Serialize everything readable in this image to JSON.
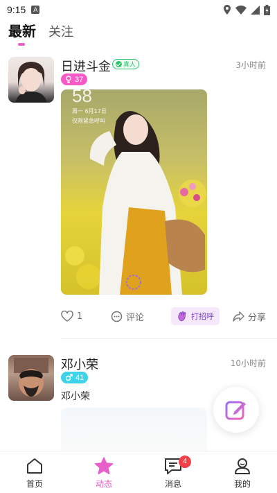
{
  "status_bar": {
    "time": "9:15",
    "notif_icon": "A"
  },
  "tabs": [
    {
      "label": "最新",
      "active": true
    },
    {
      "label": "关注",
      "active": false
    }
  ],
  "posts": [
    {
      "username": "日进斗金",
      "verified_label": "真人",
      "time": "3小时前",
      "level": "37",
      "gender": "female",
      "photo_overlay": {
        "clock": "58",
        "date": "周一 6月17日",
        "note": "仅限紧急呼叫"
      },
      "actions": {
        "likes": "1",
        "comment": "评论",
        "greet": "打招呼",
        "share": "分享"
      }
    },
    {
      "username": "邓小荣",
      "time": "10小时前",
      "level": "41",
      "gender": "male",
      "text": "邓小荣"
    }
  ],
  "bottom_nav": [
    {
      "label": "首页",
      "icon": "home-icon",
      "active": false
    },
    {
      "label": "动态",
      "icon": "star-icon",
      "active": true
    },
    {
      "label": "消息",
      "icon": "chat-icon",
      "active": false,
      "badge": "4"
    },
    {
      "label": "我的",
      "icon": "profile-icon",
      "active": false
    }
  ],
  "colors": {
    "accent": "#e85fc9",
    "female_badge": "#f75ac7",
    "male_badge": "#3ed3e8",
    "verified": "#2fc26d",
    "message_badge": "#f2404b"
  }
}
